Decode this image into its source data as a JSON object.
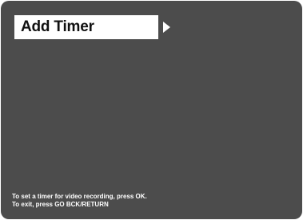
{
  "menu": {
    "selected_item": "Add Timer",
    "next_icon": "triangle-right-icon"
  },
  "help": {
    "line1": "To set a timer for video recording, press OK.",
    "line2": "To exit, press GO BCK/RETURN"
  },
  "colors": {
    "background": "#4c4c4c",
    "highlight": "#ffffff",
    "text_on_highlight": "#111111",
    "help_text": "#ffffff"
  }
}
